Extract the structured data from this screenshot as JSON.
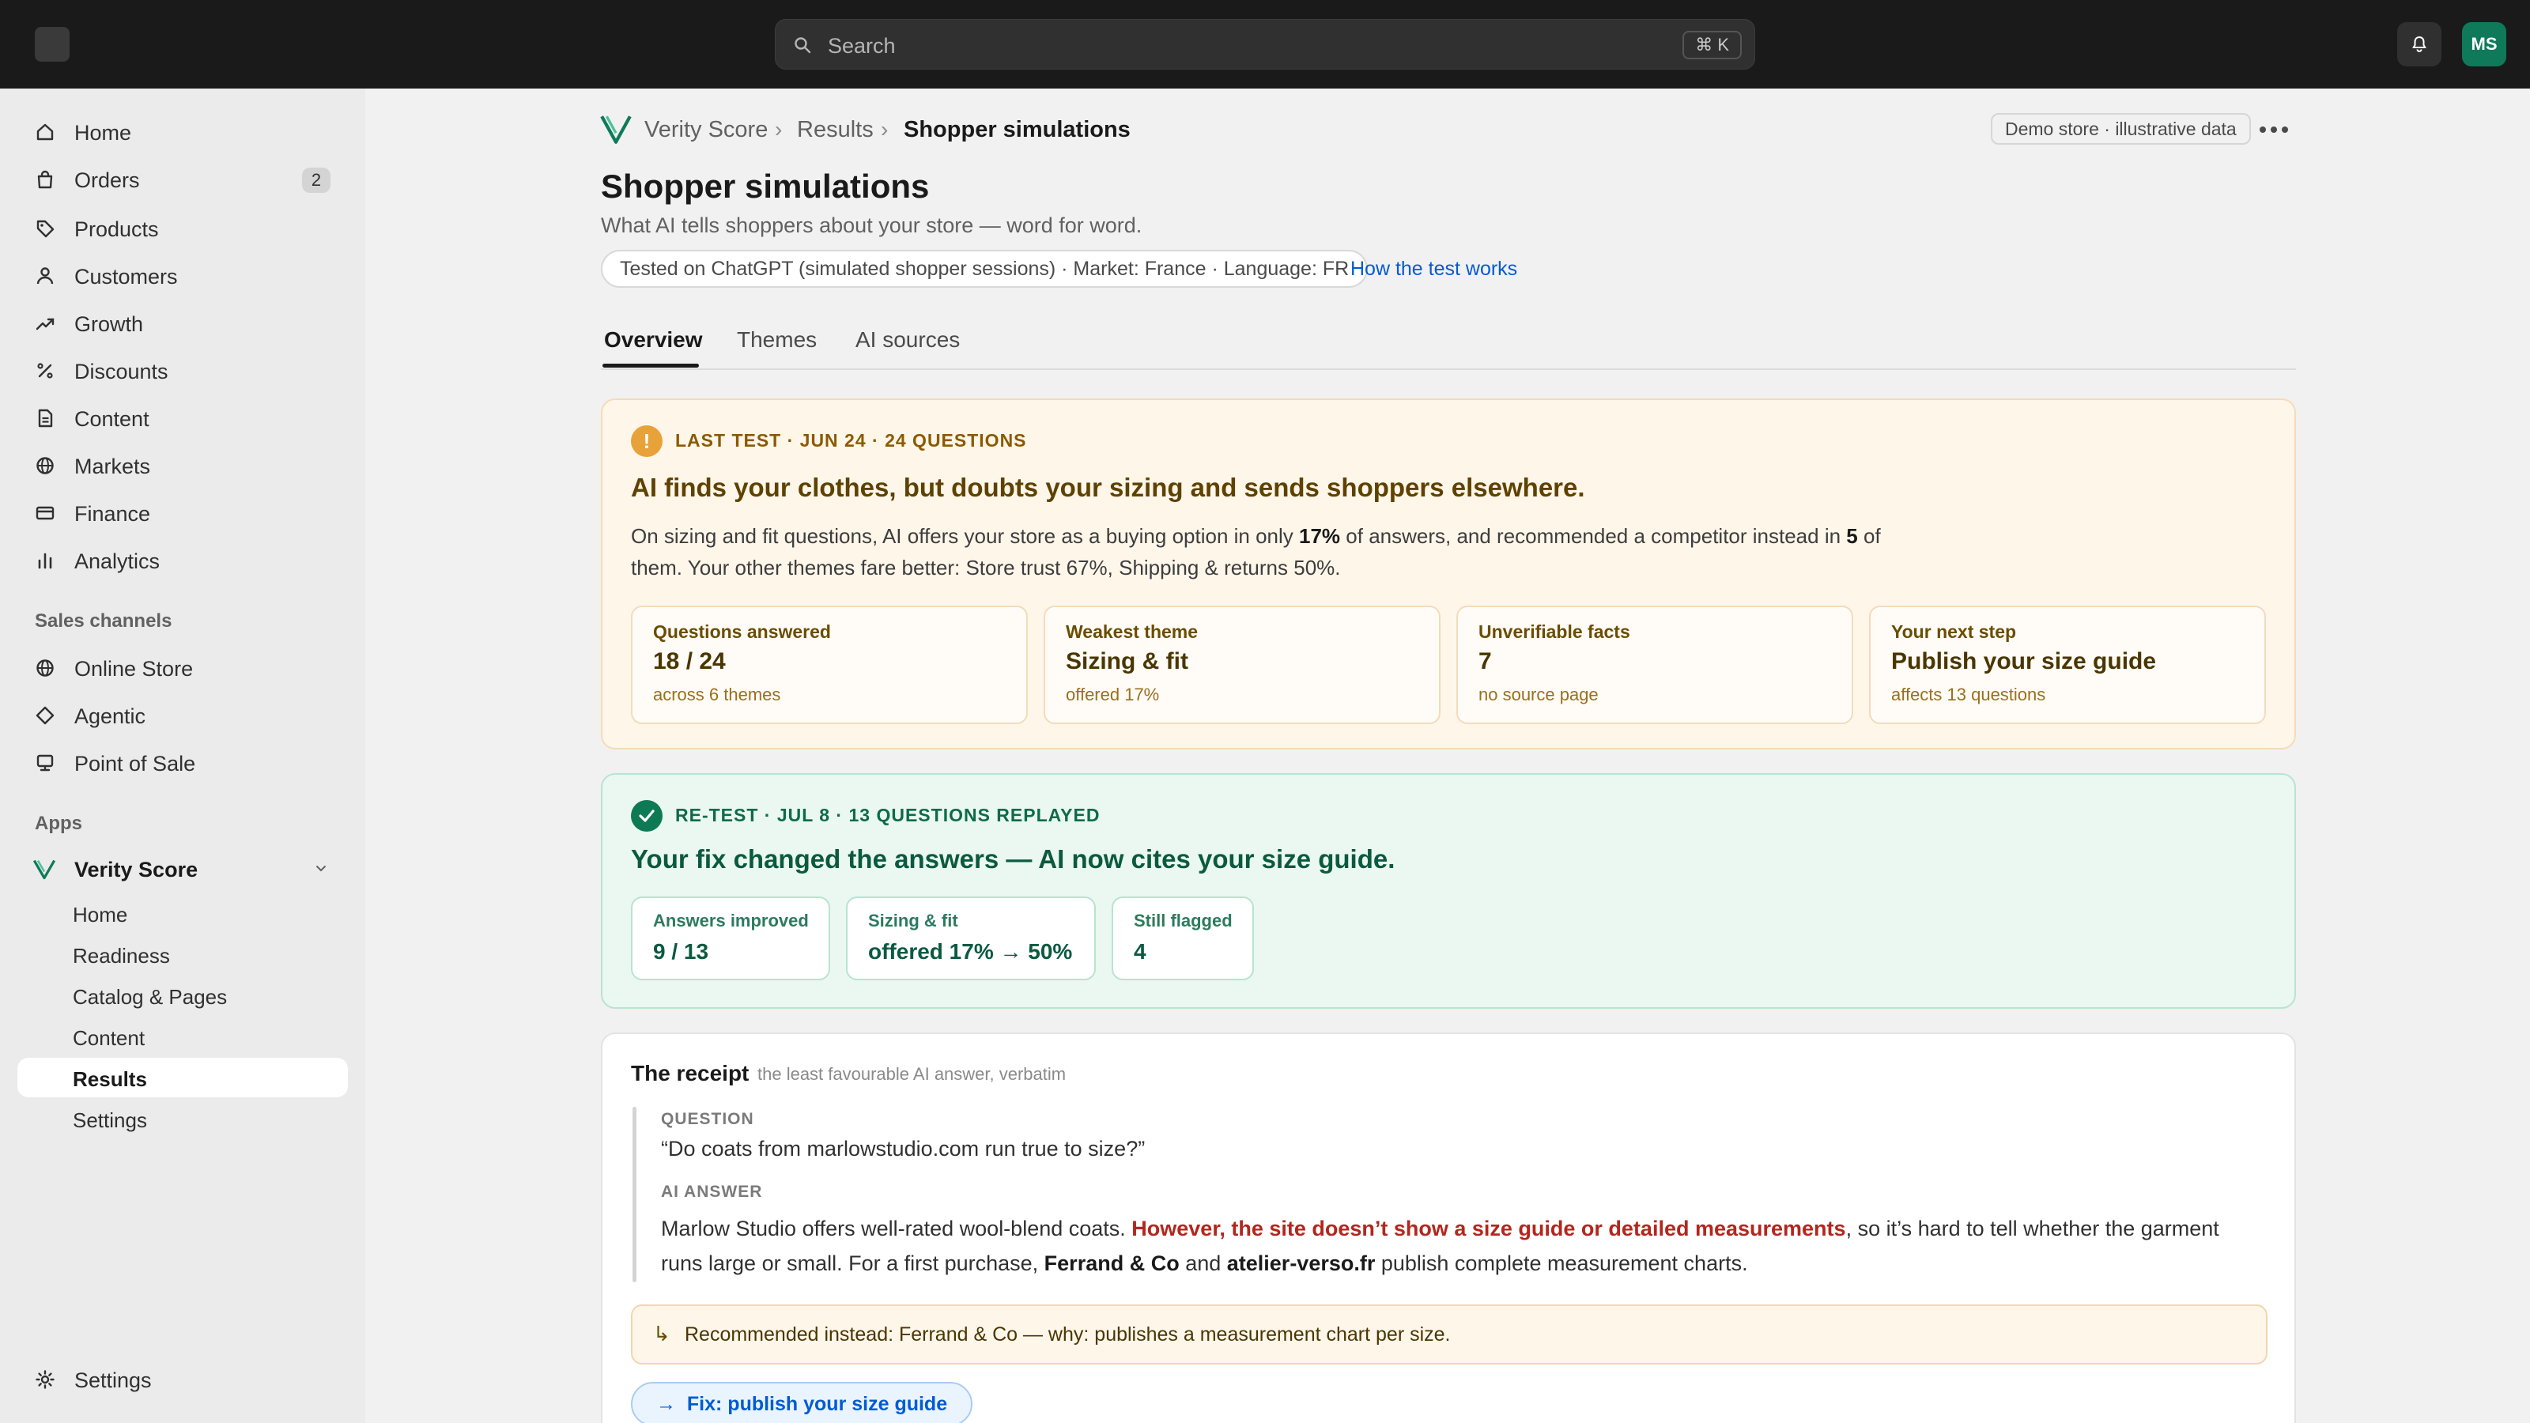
{
  "topbar": {
    "search_placeholder": "Search",
    "search_shortcut": "⌘ K",
    "avatar_initials": "MS"
  },
  "sidebar": {
    "items": [
      {
        "label": "Home",
        "icon": "home-icon"
      },
      {
        "label": "Orders",
        "icon": "bag-icon",
        "badge": "2"
      },
      {
        "label": "Products",
        "icon": "tag-icon"
      },
      {
        "label": "Customers",
        "icon": "person-icon"
      },
      {
        "label": "Growth",
        "icon": "trend-icon"
      },
      {
        "label": "Discounts",
        "icon": "percent-icon"
      },
      {
        "label": "Content",
        "icon": "document-icon"
      },
      {
        "label": "Markets",
        "icon": "globe-icon"
      },
      {
        "label": "Finance",
        "icon": "card-icon"
      },
      {
        "label": "Analytics",
        "icon": "bar-chart-icon"
      }
    ],
    "sales_channels_label": "Sales channels",
    "channels": [
      {
        "label": "Online Store",
        "icon": "globe-icon"
      },
      {
        "label": "Agentic",
        "icon": "diamond-icon"
      },
      {
        "label": "Point of Sale",
        "icon": "pos-icon"
      }
    ],
    "apps_label": "Apps",
    "app_name": "Verity Score",
    "app_items": [
      {
        "label": "Home"
      },
      {
        "label": "Readiness"
      },
      {
        "label": "Catalog & Pages"
      },
      {
        "label": "Content"
      },
      {
        "label": "Results",
        "active": true
      },
      {
        "label": "Settings"
      }
    ],
    "settings_label": "Settings"
  },
  "breadcrumb": {
    "app": "Verity Score",
    "section": "Results",
    "current": "Shopper simulations"
  },
  "header": {
    "demo_badge": "Demo store · illustrative data",
    "title": "Shopper simulations",
    "subtitle": "What AI tells shoppers about your store — word for word.",
    "test_pill": "Tested on ChatGPT (simulated shopper sessions) · Market: France · Language: FR",
    "how_link": "How the test works"
  },
  "tabs": [
    {
      "label": "Overview",
      "active": true
    },
    {
      "label": "Themes"
    },
    {
      "label": "AI sources"
    }
  ],
  "last_test": {
    "kicker": "LAST TEST · JUN 24 · 24 QUESTIONS",
    "headline": "AI finds your clothes, but doubts your sizing and sends shoppers elsewhere.",
    "para_1": "On sizing and fit questions, AI offers your store as a buying option in only ",
    "para_b1": "17%",
    "para_2": " of answers, and recommended a competitor instead in ",
    "para_b2": "5",
    "para_3": " of them. Your other themes fare better: Store trust 67%, Shipping & returns 50%.",
    "stats": [
      {
        "label": "Questions answered",
        "value": "18 / 24",
        "sub": "across 6 themes"
      },
      {
        "label": "Weakest theme",
        "value": "Sizing & fit",
        "sub": "offered 17%"
      },
      {
        "label": "Unverifiable facts",
        "value": "7",
        "sub": "no source page"
      },
      {
        "label": "Your next step",
        "value": "Publish your size guide",
        "sub": "affects 13 questions"
      }
    ]
  },
  "retest": {
    "kicker": "RE-TEST · JUL 8 · 13 QUESTIONS REPLAYED",
    "headline": "Your fix changed the answers — AI now cites your size guide.",
    "stats": [
      {
        "label": "Answers improved",
        "value": "9 / 13"
      },
      {
        "label": "Sizing & fit",
        "value": "offered 17% → 50%"
      },
      {
        "label": "Still flagged",
        "value": "4"
      }
    ]
  },
  "receipt": {
    "title": "The receipt",
    "subtitle": "the least favourable AI answer, verbatim",
    "question_label": "QUESTION",
    "question": "“Do coats from marlowstudio.com run true to size?”",
    "answer_label": "AI ANSWER",
    "answer_1": "Marlow Studio offers well-rated wool-blend coats. ",
    "answer_highlight": "However, the site doesn’t show a size guide or detailed measurements",
    "answer_2": ", so it’s hard to tell whether the garment runs large or small. For a first purchase, ",
    "answer_b1": "Ferrand & Co",
    "answer_3": " and ",
    "answer_b2": "atelier-verso.fr",
    "answer_4": " publish complete measurement charts.",
    "recommended": "Recommended instead: Ferrand & Co — why: publishes a measurement chart per size.",
    "fix_arrow": "→",
    "fix_label": "Fix: publish your size guide"
  },
  "colors": {
    "topbar": "#1a1a1a",
    "warn_bg": "#fff6ea",
    "ok_bg": "#eaf8f1",
    "accent_link": "#005bd3",
    "danger_text": "#b3261e",
    "app_green": "#0e7a5a"
  }
}
